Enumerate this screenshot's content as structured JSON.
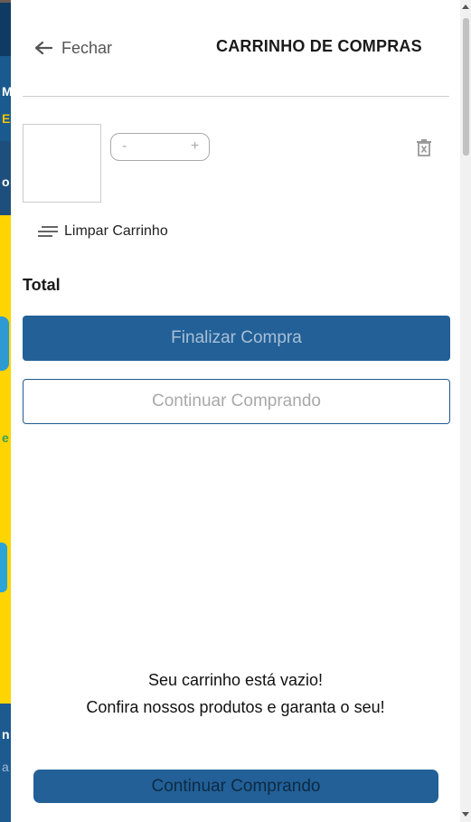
{
  "header": {
    "close_label": "Fechar",
    "title": "CARRINHO DE COMPRAS"
  },
  "cart_item": {
    "qty_minus": "-",
    "qty_plus": "+"
  },
  "actions": {
    "clear_label": "Limpar Carrinho",
    "total_label": "Total",
    "checkout_label": "Finalizar Compra",
    "continue_label": "Continuar Comprando"
  },
  "empty_state": {
    "line1": "Seu carrinho está vazio!",
    "line2": "Confira nossos produtos e garanta o seu!",
    "button_label": "Continuar Comprando"
  },
  "background_glyphs": [
    "M",
    "E",
    "o",
    "n",
    "a",
    "e"
  ],
  "icons": {
    "close": "arrow-left-icon",
    "remove": "trash-icon",
    "clear": "lines-icon"
  },
  "colors": {
    "primary": "#226097",
    "primary_text": "#a9bfd6",
    "outline_border": "#1f5b8f"
  }
}
